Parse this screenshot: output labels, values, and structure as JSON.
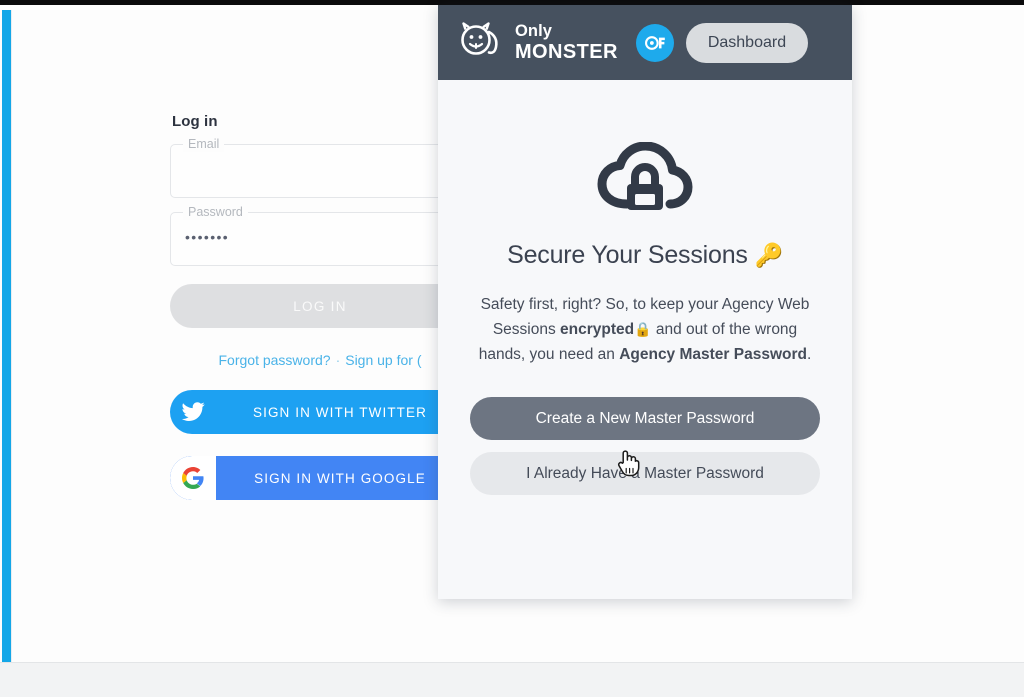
{
  "login": {
    "title": "Log in",
    "email": {
      "label": "Email",
      "value": "",
      "placeholder": "Email"
    },
    "password": {
      "label": "Password",
      "value": "•••••••",
      "placeholder": "Password"
    },
    "submit_label": "LOG IN",
    "forgot_link": "Forgot password?",
    "separator": "·",
    "signup_link": "Sign up for (",
    "twitter_label": "SIGN IN WITH TWITTER",
    "google_label": "SIGN IN WITH GOOGLE",
    "twitter_color": "#1da1f2",
    "google_color": "#4285f4",
    "link_color": "#4ab3e8",
    "accent_color": "#14a7e8"
  },
  "panel": {
    "header": {
      "brand_line1": "Only",
      "brand_line2": "MONSTER",
      "dashboard_label": "Dashboard",
      "background_color": "#46515f",
      "badge_color": "#1eaaec"
    },
    "icon_name": "cloud-lock-icon",
    "title_text": "Secure Your Sessions ",
    "title_emoji": "🔑",
    "copy": {
      "part1": "Safety first, right? So, to keep your Agency Web Sessions ",
      "bold1": "encrypted",
      "emoji": "🔒",
      "part2": " and out of the wrong hands, you need an ",
      "bold2": "Agency Master Password",
      "part3": "."
    },
    "primary_button": "Create a New Master Password",
    "secondary_button": "I Already Have a Master Password",
    "primary_color": "#6d7582",
    "secondary_color": "#e6e8eb"
  }
}
